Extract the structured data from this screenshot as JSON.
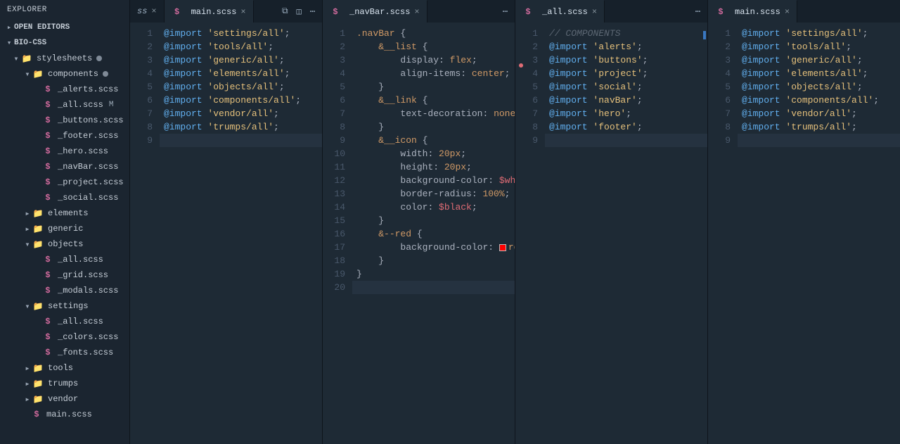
{
  "sidebar": {
    "title": "EXPLORER",
    "sections": {
      "open_editors": "OPEN EDITORS",
      "project": "BIO-CSS"
    },
    "tree": [
      {
        "kind": "folder",
        "level": 0,
        "open": true,
        "label": "stylesheets",
        "dirty": true,
        "icon": "folder-open"
      },
      {
        "kind": "folder",
        "level": 1,
        "open": true,
        "label": "components",
        "dirty": true,
        "icon": "folder-open"
      },
      {
        "kind": "file",
        "level": 2,
        "label": "_alerts.scss",
        "icon": "sass"
      },
      {
        "kind": "file",
        "level": 2,
        "label": "_all.scss",
        "icon": "sass",
        "suffix": "M"
      },
      {
        "kind": "file",
        "level": 2,
        "label": "_buttons.scss",
        "icon": "sass"
      },
      {
        "kind": "file",
        "level": 2,
        "label": "_footer.scss",
        "icon": "sass"
      },
      {
        "kind": "file",
        "level": 2,
        "label": "_hero.scss",
        "icon": "sass"
      },
      {
        "kind": "file",
        "level": 2,
        "label": "_navBar.scss",
        "icon": "sass"
      },
      {
        "kind": "file",
        "level": 2,
        "label": "_project.scss",
        "icon": "sass"
      },
      {
        "kind": "file",
        "level": 2,
        "label": "_social.scss",
        "icon": "sass"
      },
      {
        "kind": "folder",
        "level": 1,
        "open": false,
        "label": "elements",
        "icon": "folder"
      },
      {
        "kind": "folder",
        "level": 1,
        "open": false,
        "label": "generic",
        "icon": "folder"
      },
      {
        "kind": "folder",
        "level": 1,
        "open": true,
        "label": "objects",
        "icon": "folder-open"
      },
      {
        "kind": "file",
        "level": 2,
        "label": "_all.scss",
        "icon": "sass"
      },
      {
        "kind": "file",
        "level": 2,
        "label": "_grid.scss",
        "icon": "sass"
      },
      {
        "kind": "file",
        "level": 2,
        "label": "_modals.scss",
        "icon": "sass"
      },
      {
        "kind": "folder",
        "level": 1,
        "open": true,
        "label": "settings",
        "icon": "folder-settings"
      },
      {
        "kind": "file",
        "level": 2,
        "label": "_all.scss",
        "icon": "sass"
      },
      {
        "kind": "file",
        "level": 2,
        "label": "_colors.scss",
        "icon": "sass"
      },
      {
        "kind": "file",
        "level": 2,
        "label": "_fonts.scss",
        "icon": "sass"
      },
      {
        "kind": "folder",
        "level": 1,
        "open": false,
        "label": "tools",
        "icon": "folder-settings"
      },
      {
        "kind": "folder",
        "level": 1,
        "open": false,
        "label": "trumps",
        "icon": "folder"
      },
      {
        "kind": "folder",
        "level": 1,
        "open": false,
        "label": "vendor",
        "icon": "folder"
      },
      {
        "kind": "file",
        "level": 1,
        "label": "main.scss",
        "icon": "sass"
      }
    ]
  },
  "panes": [
    {
      "tabs": [
        {
          "label": "ss",
          "trail": true
        },
        {
          "label": "main.scss",
          "active": true
        }
      ],
      "actions": [
        "diff-icon",
        "split-icon",
        "more-icon"
      ],
      "lines": [
        {
          "n": 1,
          "tokens": [
            {
              "t": "@import ",
              "c": "dir"
            },
            {
              "t": "'settings/all'",
              "c": "str"
            },
            {
              "t": ";",
              "c": "punc"
            }
          ]
        },
        {
          "n": 2,
          "tokens": [
            {
              "t": "@import ",
              "c": "dir"
            },
            {
              "t": "'tools/all'",
              "c": "str"
            },
            {
              "t": ";",
              "c": "punc"
            }
          ]
        },
        {
          "n": 3,
          "tokens": [
            {
              "t": "@import ",
              "c": "dir"
            },
            {
              "t": "'generic/all'",
              "c": "str"
            },
            {
              "t": ";",
              "c": "punc"
            }
          ]
        },
        {
          "n": 4,
          "tokens": [
            {
              "t": "@import ",
              "c": "dir"
            },
            {
              "t": "'elements/all'",
              "c": "str"
            },
            {
              "t": ";",
              "c": "punc"
            }
          ]
        },
        {
          "n": 5,
          "tokens": [
            {
              "t": "@import ",
              "c": "dir"
            },
            {
              "t": "'objects/all'",
              "c": "str"
            },
            {
              "t": ";",
              "c": "punc"
            }
          ]
        },
        {
          "n": 6,
          "tokens": [
            {
              "t": "@import ",
              "c": "dir"
            },
            {
              "t": "'components/all'",
              "c": "str"
            },
            {
              "t": ";",
              "c": "punc"
            }
          ]
        },
        {
          "n": 7,
          "tokens": [
            {
              "t": "@import ",
              "c": "dir"
            },
            {
              "t": "'vendor/all'",
              "c": "str"
            },
            {
              "t": ";",
              "c": "punc"
            }
          ]
        },
        {
          "n": 8,
          "tokens": [
            {
              "t": "@import ",
              "c": "dir"
            },
            {
              "t": "'trumps/all'",
              "c": "str"
            },
            {
              "t": ";",
              "c": "punc"
            }
          ]
        },
        {
          "n": 9,
          "current": true,
          "tokens": []
        }
      ]
    },
    {
      "tabs": [
        {
          "label": "_navBar.scss",
          "active": true
        }
      ],
      "actions": [
        "more-icon"
      ],
      "lines": [
        {
          "n": 1,
          "tokens": [
            {
              "t": ".navBar ",
              "c": "sel"
            },
            {
              "t": "{",
              "c": "punc"
            }
          ]
        },
        {
          "n": 2,
          "tokens": [
            {
              "t": "    ",
              "c": ""
            },
            {
              "t": "&__list ",
              "c": "sel"
            },
            {
              "t": "{",
              "c": "punc"
            }
          ]
        },
        {
          "n": 3,
          "tokens": [
            {
              "t": "        ",
              "c": ""
            },
            {
              "t": "display",
              "c": "prop"
            },
            {
              "t": ": ",
              "c": "punc"
            },
            {
              "t": "flex",
              "c": "val"
            },
            {
              "t": ";",
              "c": "punc"
            }
          ]
        },
        {
          "n": 4,
          "tokens": [
            {
              "t": "        ",
              "c": ""
            },
            {
              "t": "align-items",
              "c": "prop"
            },
            {
              "t": ": ",
              "c": "punc"
            },
            {
              "t": "center",
              "c": "val"
            },
            {
              "t": ";",
              "c": "punc"
            }
          ]
        },
        {
          "n": 5,
          "tokens": [
            {
              "t": "    ",
              "c": ""
            },
            {
              "t": "}",
              "c": "punc"
            }
          ]
        },
        {
          "n": 6,
          "tokens": [
            {
              "t": "    ",
              "c": ""
            },
            {
              "t": "&__link ",
              "c": "sel"
            },
            {
              "t": "{",
              "c": "punc"
            }
          ]
        },
        {
          "n": 7,
          "tokens": [
            {
              "t": "        ",
              "c": ""
            },
            {
              "t": "text-decoration",
              "c": "prop"
            },
            {
              "t": ": ",
              "c": "punc"
            },
            {
              "t": "none",
              "c": "val"
            },
            {
              "t": ";",
              "c": "punc"
            }
          ]
        },
        {
          "n": 8,
          "tokens": [
            {
              "t": "    ",
              "c": ""
            },
            {
              "t": "}",
              "c": "punc"
            }
          ]
        },
        {
          "n": 9,
          "tokens": [
            {
              "t": "    ",
              "c": ""
            },
            {
              "t": "&__icon ",
              "c": "sel"
            },
            {
              "t": "{",
              "c": "punc"
            }
          ]
        },
        {
          "n": 10,
          "tokens": [
            {
              "t": "        ",
              "c": ""
            },
            {
              "t": "width",
              "c": "prop"
            },
            {
              "t": ": ",
              "c": "punc"
            },
            {
              "t": "20px",
              "c": "num"
            },
            {
              "t": ";",
              "c": "punc"
            }
          ]
        },
        {
          "n": 11,
          "tokens": [
            {
              "t": "        ",
              "c": ""
            },
            {
              "t": "height",
              "c": "prop"
            },
            {
              "t": ": ",
              "c": "punc"
            },
            {
              "t": "20px",
              "c": "num"
            },
            {
              "t": ";",
              "c": "punc"
            }
          ]
        },
        {
          "n": 12,
          "tokens": [
            {
              "t": "        ",
              "c": ""
            },
            {
              "t": "background-color",
              "c": "prop"
            },
            {
              "t": ": ",
              "c": "punc"
            },
            {
              "t": "$white",
              "c": "var"
            },
            {
              "t": ";",
              "c": "punc"
            }
          ]
        },
        {
          "n": 13,
          "tokens": [
            {
              "t": "        ",
              "c": ""
            },
            {
              "t": "border-radius",
              "c": "prop"
            },
            {
              "t": ": ",
              "c": "punc"
            },
            {
              "t": "100%",
              "c": "num"
            },
            {
              "t": ";",
              "c": "punc"
            }
          ]
        },
        {
          "n": 14,
          "tokens": [
            {
              "t": "        ",
              "c": ""
            },
            {
              "t": "color",
              "c": "prop"
            },
            {
              "t": ": ",
              "c": "punc"
            },
            {
              "t": "$black",
              "c": "var"
            },
            {
              "t": ";",
              "c": "punc"
            }
          ]
        },
        {
          "n": 15,
          "tokens": [
            {
              "t": "    ",
              "c": ""
            },
            {
              "t": "}",
              "c": "punc"
            }
          ]
        },
        {
          "n": 16,
          "tokens": [
            {
              "t": "    ",
              "c": ""
            },
            {
              "t": "&--red ",
              "c": "sel"
            },
            {
              "t": "{",
              "c": "punc"
            }
          ]
        },
        {
          "n": 17,
          "tokens": [
            {
              "t": "        ",
              "c": ""
            },
            {
              "t": "background-color",
              "c": "prop"
            },
            {
              "t": ": ",
              "c": "punc"
            },
            {
              "swatch": true
            },
            {
              "t": "red",
              "c": "val"
            },
            {
              "t": ";",
              "c": "punc"
            }
          ]
        },
        {
          "n": 18,
          "tokens": [
            {
              "t": "    ",
              "c": ""
            },
            {
              "t": "}",
              "c": "punc"
            }
          ]
        },
        {
          "n": 19,
          "tokens": [
            {
              "t": "}",
              "c": "punc"
            }
          ]
        },
        {
          "n": 20,
          "current": true,
          "tokens": []
        }
      ]
    },
    {
      "tabs": [
        {
          "label": "_all.scss",
          "active": true
        }
      ],
      "actions": [
        "more-icon"
      ],
      "gitmark": true,
      "lines": [
        {
          "n": 1,
          "tokens": [
            {
              "t": "// COMPONENTS",
              "c": "cmt"
            }
          ]
        },
        {
          "n": 2,
          "tokens": [
            {
              "t": "@import ",
              "c": "dir"
            },
            {
              "t": "'alerts'",
              "c": "str"
            },
            {
              "t": ";",
              "c": "punc"
            }
          ]
        },
        {
          "n": 3,
          "tokens": [
            {
              "t": "@import ",
              "c": "dir"
            },
            {
              "t": "'buttons'",
              "c": "str"
            },
            {
              "t": ";",
              "c": "punc"
            }
          ]
        },
        {
          "n": 4,
          "tokens": [
            {
              "t": "@import ",
              "c": "dir"
            },
            {
              "t": "'project'",
              "c": "str"
            },
            {
              "t": ";",
              "c": "punc"
            }
          ]
        },
        {
          "n": 5,
          "tokens": [
            {
              "t": "@import ",
              "c": "dir"
            },
            {
              "t": "'social'",
              "c": "str"
            },
            {
              "t": ";",
              "c": "punc"
            }
          ]
        },
        {
          "n": 6,
          "tokens": [
            {
              "t": "@import ",
              "c": "dir"
            },
            {
              "t": "'navBar'",
              "c": "str"
            },
            {
              "t": ";",
              "c": "punc"
            }
          ]
        },
        {
          "n": 7,
          "tokens": [
            {
              "t": "@import ",
              "c": "dir"
            },
            {
              "t": "'hero'",
              "c": "str"
            },
            {
              "t": ";",
              "c": "punc"
            }
          ]
        },
        {
          "n": 8,
          "tokens": [
            {
              "t": "@import ",
              "c": "dir"
            },
            {
              "t": "'footer'",
              "c": "str"
            },
            {
              "t": ";",
              "c": "punc"
            }
          ]
        },
        {
          "n": 9,
          "current": true,
          "tokens": []
        }
      ]
    },
    {
      "tabs": [
        {
          "label": "main.scss",
          "active": true
        }
      ],
      "actions": [],
      "lines": [
        {
          "n": 1,
          "tokens": [
            {
              "t": "@import ",
              "c": "dir"
            },
            {
              "t": "'settings/all'",
              "c": "str"
            },
            {
              "t": ";",
              "c": "punc"
            }
          ]
        },
        {
          "n": 2,
          "tokens": [
            {
              "t": "@import ",
              "c": "dir"
            },
            {
              "t": "'tools/all'",
              "c": "str"
            },
            {
              "t": ";",
              "c": "punc"
            }
          ]
        },
        {
          "n": 3,
          "tokens": [
            {
              "t": "@import ",
              "c": "dir"
            },
            {
              "t": "'generic/all'",
              "c": "str"
            },
            {
              "t": ";",
              "c": "punc"
            }
          ]
        },
        {
          "n": 4,
          "tokens": [
            {
              "t": "@import ",
              "c": "dir"
            },
            {
              "t": "'elements/all'",
              "c": "str"
            },
            {
              "t": ";",
              "c": "punc"
            }
          ]
        },
        {
          "n": 5,
          "tokens": [
            {
              "t": "@import ",
              "c": "dir"
            },
            {
              "t": "'objects/all'",
              "c": "str"
            },
            {
              "t": ";",
              "c": "punc"
            }
          ]
        },
        {
          "n": 6,
          "tokens": [
            {
              "t": "@import ",
              "c": "dir"
            },
            {
              "t": "'components/all'",
              "c": "str"
            },
            {
              "t": ";",
              "c": "punc"
            }
          ]
        },
        {
          "n": 7,
          "tokens": [
            {
              "t": "@import ",
              "c": "dir"
            },
            {
              "t": "'vendor/all'",
              "c": "str"
            },
            {
              "t": ";",
              "c": "punc"
            }
          ]
        },
        {
          "n": 8,
          "tokens": [
            {
              "t": "@import ",
              "c": "dir"
            },
            {
              "t": "'trumps/all'",
              "c": "str"
            },
            {
              "t": ";",
              "c": "punc"
            }
          ]
        },
        {
          "n": 9,
          "current": true,
          "tokens": []
        }
      ]
    }
  ],
  "glyphs": {
    "diff-icon": "⧉",
    "split-icon": "◫",
    "more-icon": "⋯",
    "close": "×"
  }
}
